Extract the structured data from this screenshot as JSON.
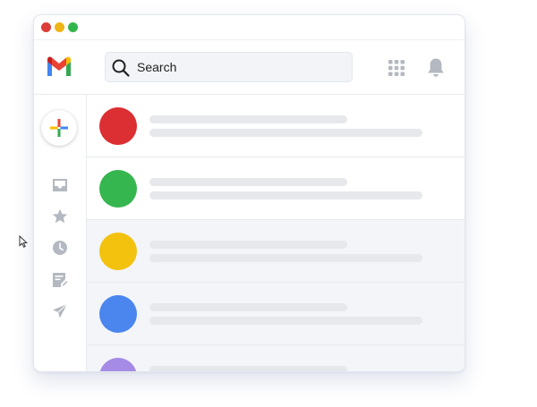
{
  "colors": {
    "window_controls": [
      "#dc3d3a",
      "#efb415",
      "#33b54d"
    ],
    "icon_gray": "#b4b8c0",
    "unread_row": "#ffffff",
    "read_row": "#f3f5f9",
    "placeholder_line": "#e7e8ec"
  },
  "header": {
    "logo_icon": "gmail-logo-icon",
    "search_icon": "search-icon",
    "search_label": "Search",
    "apps_icon": "apps-grid-icon",
    "notifications_icon": "bell-icon"
  },
  "sidebar": {
    "compose_icon": "plus-icon",
    "items": [
      {
        "icon": "inbox-icon"
      },
      {
        "icon": "star-icon"
      },
      {
        "icon": "clock-icon"
      },
      {
        "icon": "drafts-icon"
      },
      {
        "icon": "send-icon"
      }
    ]
  },
  "messages": [
    {
      "avatar_color": "#dc2f33",
      "read": false
    },
    {
      "avatar_color": "#36b64f",
      "read": false
    },
    {
      "avatar_color": "#f3c20f",
      "read": true
    },
    {
      "avatar_color": "#4a86ee",
      "read": true
    },
    {
      "avatar_color": "#a58be6",
      "read": true
    }
  ]
}
